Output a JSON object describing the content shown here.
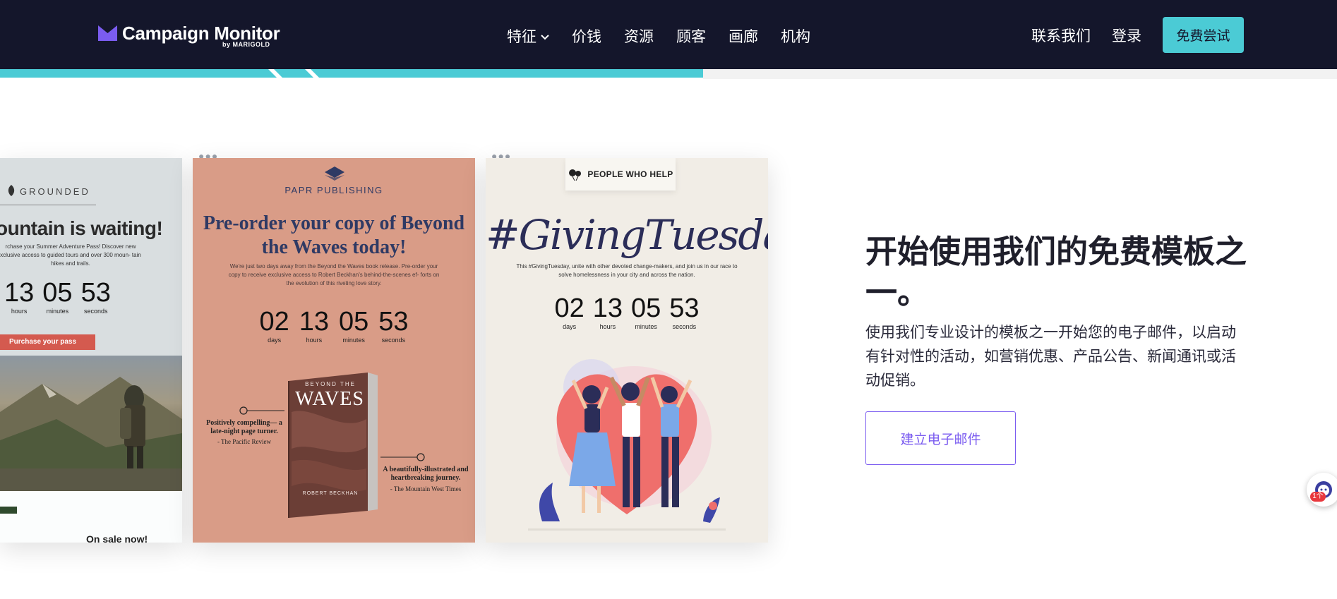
{
  "header": {
    "logo_text": "Campaign Monitor",
    "logo_sub": "by MARIGOLD",
    "nav": [
      {
        "label": "特征",
        "has_dropdown": true
      },
      {
        "label": "价钱"
      },
      {
        "label": "资源"
      },
      {
        "label": "顾客"
      },
      {
        "label": "画廊"
      },
      {
        "label": "机构"
      }
    ],
    "contact": "联系我们",
    "login": "登录",
    "try_free": "免费尝试"
  },
  "cards": {
    "card1": {
      "brand": "GROUNDED",
      "title": "ountain is waiting!",
      "body": "rchase your Summer Adventure Pass! Discover new xclusive access to guided tours and over 300 moun- tain hikes and trails.",
      "countdown": [
        {
          "n": "13",
          "l": "hours"
        },
        {
          "n": "05",
          "l": "minutes"
        },
        {
          "n": "53",
          "l": "seconds"
        }
      ],
      "button": "Purchase your pass",
      "footer": "On sale now!"
    },
    "card2": {
      "brand": "PAPR PUBLISHING",
      "title": "Pre-order your copy of Beyond the Waves today!",
      "body": "We're just two days away from the Beyond the Waves book release. Pre-order your copy to receive exclusive access to Robert Beckhan's behind-the-scenes ef- forts on the evolution of this riveting love story.",
      "countdown": [
        {
          "n": "02",
          "l": "days"
        },
        {
          "n": "13",
          "l": "hours"
        },
        {
          "n": "05",
          "l": "minutes"
        },
        {
          "n": "53",
          "l": "seconds"
        }
      ],
      "book_top": "BEYOND THE",
      "book_title": "WAVES",
      "book_author": "ROBERT BECKHAN",
      "quote1": "Positively compelling— a late-night page turner.",
      "source1": "- The Pacific Review",
      "quote2": "A beautifully-illustrated and heartbreaking journey.",
      "source2": "- The Mountain West Times"
    },
    "card3": {
      "tag": "PEOPLE WHO HELP",
      "title": "#GivingTuesday",
      "body": "This #GivingTuesday, unite with other devoted change-makers, and join us in our race to solve homelessness in your city and across the nation.",
      "countdown": [
        {
          "n": "02",
          "l": "days"
        },
        {
          "n": "13",
          "l": "hours"
        },
        {
          "n": "05",
          "l": "minutes"
        },
        {
          "n": "53",
          "l": "seconds"
        }
      ]
    }
  },
  "hero": {
    "headline": "开始使用我们的免费模板之一。",
    "subtext": "使用我们专业设计的模板之一开始您的电子邮件，以启动有针对性的活动，如营销优惠、产品公告、新闻通讯或活动促销。",
    "cta": "建立电子邮件"
  },
  "chat": {
    "badge": "1个"
  },
  "colors": {
    "header_bg": "#14162b",
    "accent": "#4bcbd5",
    "cta_purple": "#7b5cf0"
  }
}
